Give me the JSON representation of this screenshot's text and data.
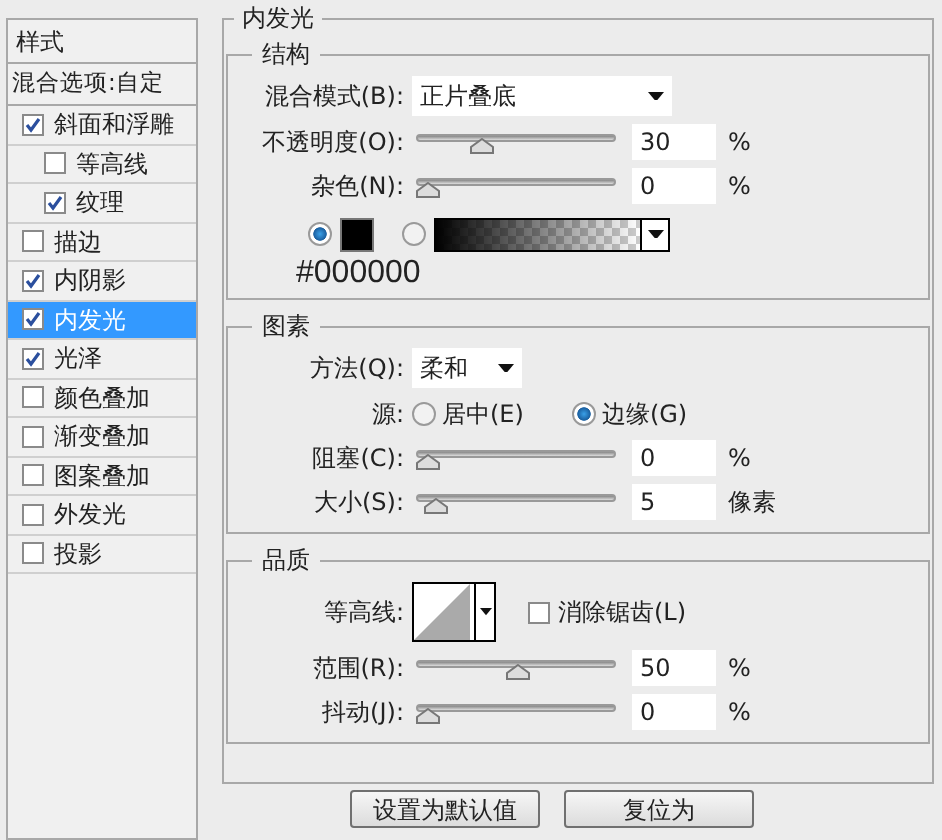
{
  "sidebar": {
    "title": "样式",
    "blend_options": "混合选项:自定",
    "items": [
      {
        "label": "斜面和浮雕",
        "checked": true,
        "selected": false,
        "children": [
          {
            "label": "等高线",
            "checked": false,
            "selected": false
          },
          {
            "label": "纹理",
            "checked": true,
            "selected": false
          }
        ]
      },
      {
        "label": "描边",
        "checked": false,
        "selected": false
      },
      {
        "label": "内阴影",
        "checked": true,
        "selected": false
      },
      {
        "label": "内发光",
        "checked": true,
        "selected": true
      },
      {
        "label": "光泽",
        "checked": true,
        "selected": false
      },
      {
        "label": "颜色叠加",
        "checked": false,
        "selected": false
      },
      {
        "label": "渐变叠加",
        "checked": false,
        "selected": false
      },
      {
        "label": "图案叠加",
        "checked": false,
        "selected": false
      },
      {
        "label": "外发光",
        "checked": false,
        "selected": false
      },
      {
        "label": "投影",
        "checked": false,
        "selected": false
      }
    ]
  },
  "panel": {
    "title": "内发光",
    "sections": [
      {
        "title": "结构",
        "rows": [
          {
            "kind": "select",
            "label": "混合模式(B):",
            "value": "正片叠底",
            "wide": true
          },
          {
            "kind": "slider",
            "label": "不透明度(O):",
            "level": 0.3,
            "value": "30",
            "unit": "%"
          },
          {
            "kind": "slider",
            "label": "杂色(N):",
            "level": 0,
            "value": "0",
            "unit": "%"
          },
          {
            "kind": "color",
            "solid_selected": true,
            "color": "#000000",
            "annotation": "#000000"
          }
        ]
      },
      {
        "title": "图素",
        "rows": [
          {
            "kind": "select",
            "label": "方法(Q):",
            "value": "柔和",
            "wide": false
          },
          {
            "kind": "radio",
            "label": "源:",
            "options": [
              {
                "label": "居中(E)",
                "selected": false
              },
              {
                "label": "边缘(G)",
                "selected": true
              }
            ]
          },
          {
            "kind": "slider",
            "label": "阻塞(C):",
            "level": 0,
            "value": "0",
            "unit": "%"
          },
          {
            "kind": "slider",
            "label": "大小(S):",
            "level": 0.04,
            "value": "5",
            "unit": "像素"
          }
        ]
      },
      {
        "title": "品质",
        "rows": [
          {
            "kind": "contour",
            "label": "等高线:",
            "antialias": {
              "label": "消除锯齿(L)",
              "checked": false
            }
          },
          {
            "kind": "slider",
            "label": "范围(R):",
            "level": 0.5,
            "value": "50",
            "unit": "%"
          },
          {
            "kind": "slider",
            "label": "抖动(J):",
            "level": 0,
            "value": "0",
            "unit": "%"
          }
        ]
      }
    ]
  },
  "buttons": [
    "设置为默认值",
    "复位为"
  ]
}
